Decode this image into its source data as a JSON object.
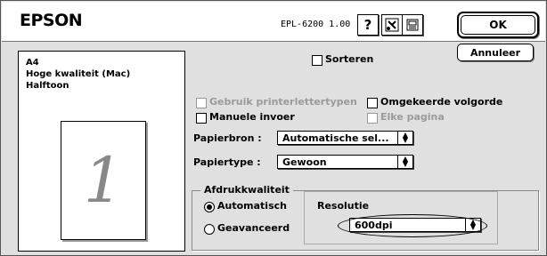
{
  "header": {
    "brand": "EPSON",
    "model": "EPL-6200  1.00",
    "help_glyph": "?",
    "icon1_name": "tools-icon",
    "icon2_name": "printer-settings-icon",
    "ok_label": "OK",
    "cancel_label": "Annuleer"
  },
  "summary": {
    "paper_size": "A4",
    "quality": "Hoge kwaliteit (Mac)",
    "halftone": "Halftoon",
    "page_number": "1"
  },
  "options": {
    "sort_label": "Sorteren",
    "printer_fonts_label": "Gebruik printerlettertypen",
    "reverse_order_label": "Omgekeerde volgorde",
    "manual_feed_label": "Manuele invoer",
    "each_page_label": "Elke pagina"
  },
  "fields": {
    "paper_source_label": "Papierbron :",
    "paper_source_value": "Automatische sel...",
    "paper_type_label": "Papiertype :",
    "paper_type_value": "Gewoon"
  },
  "quality_group": {
    "title": "Afdrukkwaliteit",
    "auto_label": "Automatisch",
    "advanced_label": "Geavanceerd",
    "resolution_label": "Resolutie",
    "resolution_value": "600dpi",
    "selected": "Automatisch"
  }
}
